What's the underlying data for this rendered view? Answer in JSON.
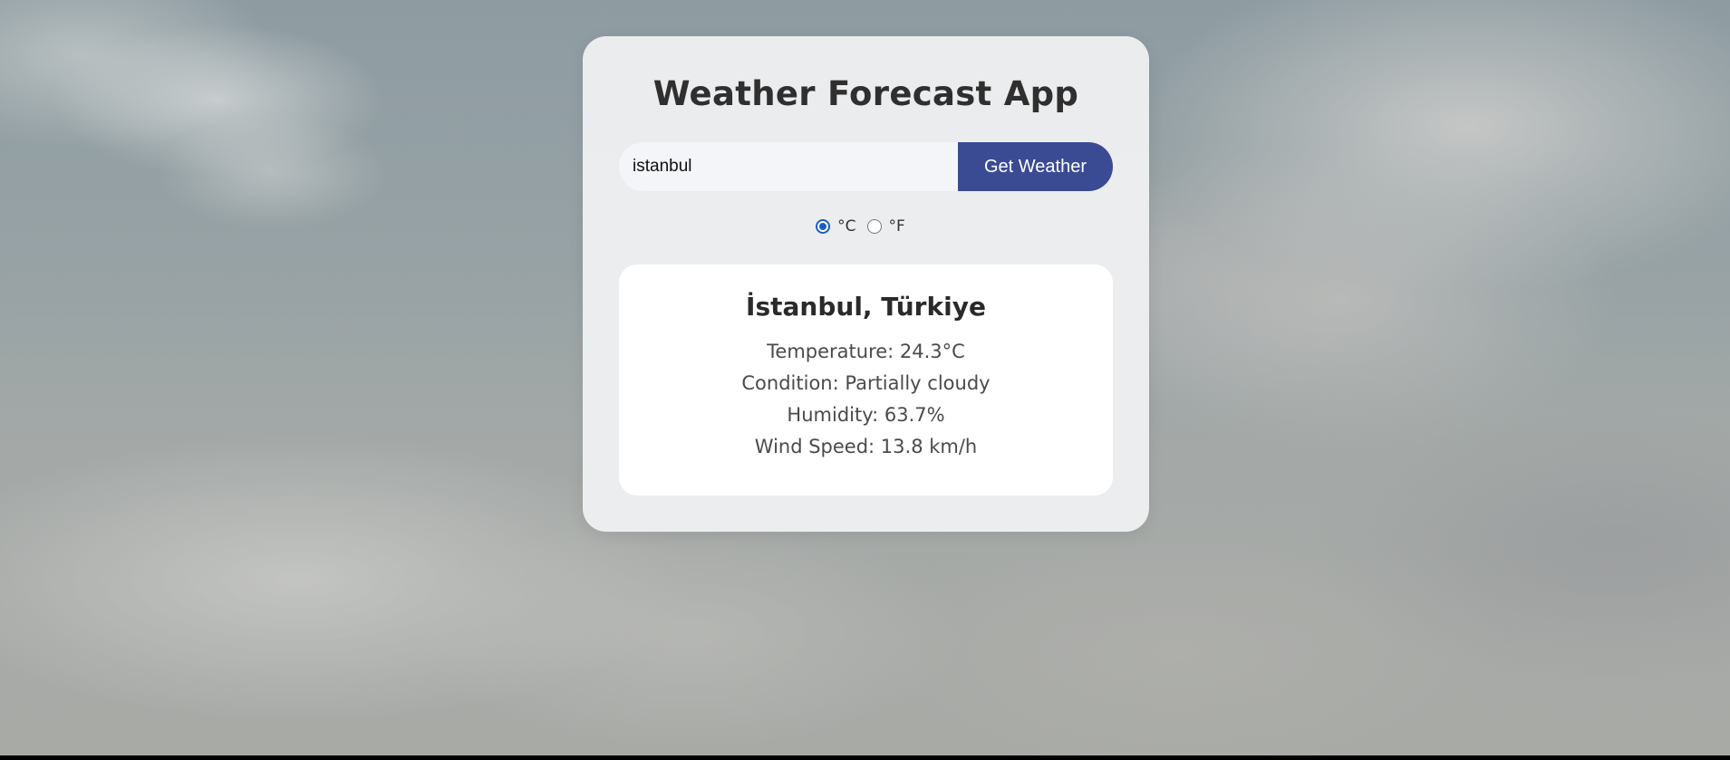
{
  "app": {
    "title": "Weather Forecast App"
  },
  "search": {
    "value": "istanbul",
    "placeholder": "",
    "button_label": "Get Weather"
  },
  "units": {
    "options": [
      {
        "label": "°C",
        "selected": true
      },
      {
        "label": "°F",
        "selected": false
      }
    ]
  },
  "result": {
    "location": "İstanbul, Türkiye",
    "temperature": "Temperature: 24.3°C",
    "condition": "Condition: Partially cloudy",
    "humidity": "Humidity: 63.7%",
    "wind": "Wind Speed: 13.8 km/h"
  },
  "colors": {
    "button": "#3a4b93",
    "radio_accent": "#1a5fc4"
  }
}
